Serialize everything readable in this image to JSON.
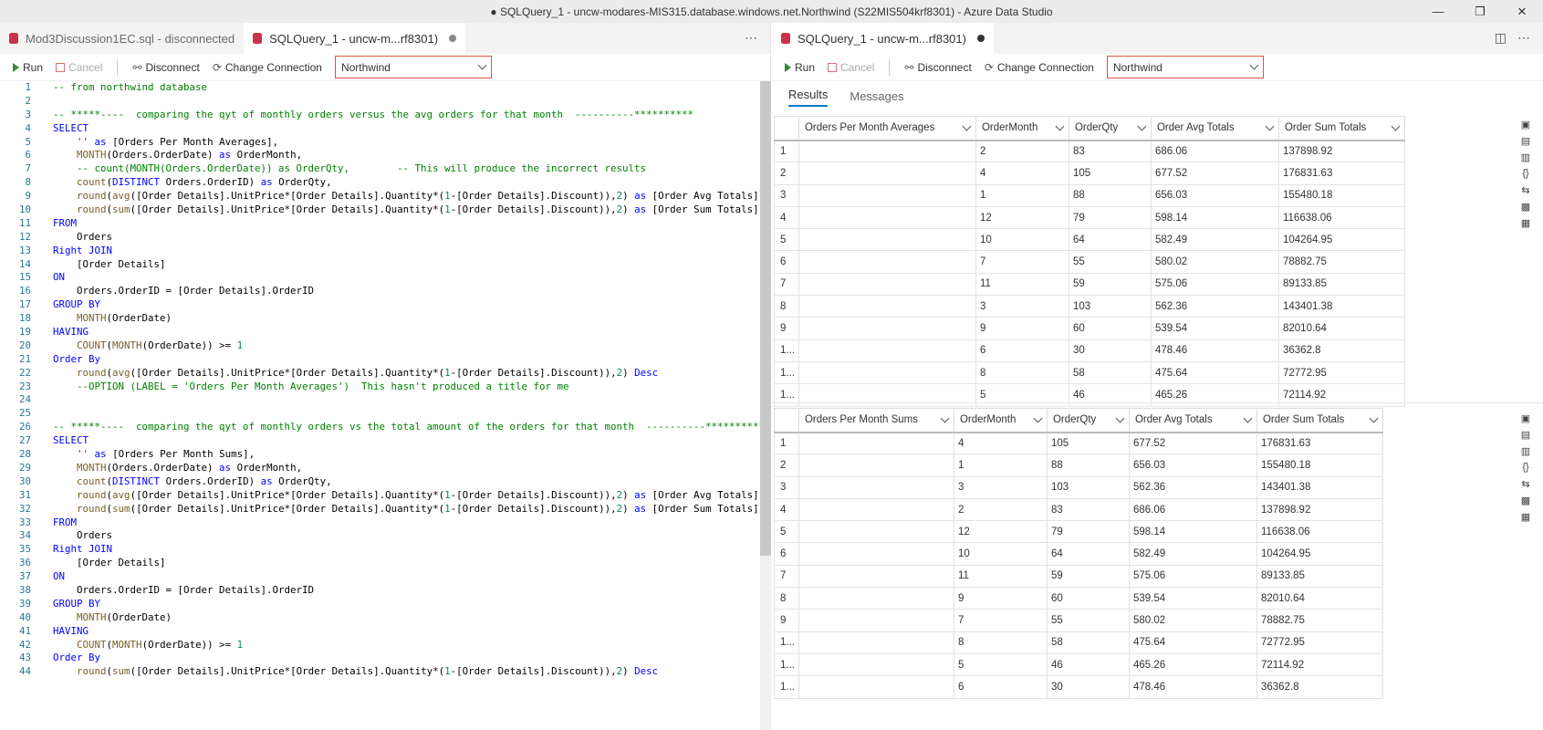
{
  "window": {
    "title": "● SQLQuery_1 - uncw-modares-MIS315.database.windows.net.Northwind (S22MIS504krf8301) - Azure Data Studio"
  },
  "left_tabs": [
    {
      "label": "Mod3Discussion1EC.sql - disconnected"
    },
    {
      "label": "SQLQuery_1 - uncw-m...rf8301)"
    }
  ],
  "right_tab": {
    "label": "SQLQuery_1 - uncw-m...rf8301)"
  },
  "toolbar": {
    "run": "Run",
    "cancel": "Cancel",
    "disconnect": "Disconnect",
    "change_connection": "Change Connection",
    "database": "Northwind"
  },
  "results_tabs": {
    "results": "Results",
    "messages": "Messages"
  },
  "editor_lines": [
    "1",
    "2",
    "3",
    "4",
    "5",
    "6",
    "7",
    "8",
    "9",
    "10",
    "11",
    "12",
    "13",
    "14",
    "15",
    "16",
    "17",
    "18",
    "19",
    "20",
    "21",
    "22",
    "23",
    "24",
    "25",
    "26",
    "27",
    "28",
    "29",
    "30",
    "31",
    "32",
    "33",
    "34",
    "35",
    "36",
    "37",
    "38",
    "39",
    "40",
    "41",
    "42",
    "43",
    "44"
  ],
  "code": [
    "-- from northwind database",
    "",
    "-- *****----  comparing the qyt of monthly orders versus the avg orders for that month  ----------**********",
    "SELECT",
    "    '' as [Orders Per Month Averages],",
    "    MONTH(Orders.OrderDate) as OrderMonth,",
    "    -- count(MONTH(Orders.OrderDate)) as OrderQty,        -- This will produce the incorrect results",
    "    count(DISTINCT Orders.OrderID) as OrderQty,",
    "    round(avg([Order Details].UnitPrice*[Order Details].Quantity*(1-[Order Details].Discount)),2) as [Order Avg Totals],",
    "    round(sum([Order Details].UnitPrice*[Order Details].Quantity*(1-[Order Details].Discount)),2) as [Order Sum Totals]",
    "FROM",
    "    Orders",
    "Right JOIN",
    "    [Order Details]",
    "ON",
    "    Orders.OrderID = [Order Details].OrderID",
    "GROUP BY",
    "    MONTH(OrderDate)",
    "HAVING",
    "    COUNT(MONTH(OrderDate)) >= 1",
    "Order By",
    "    round(avg([Order Details].UnitPrice*[Order Details].Quantity*(1-[Order Details].Discount)),2) Desc",
    "    --OPTION (LABEL = 'Orders Per Month Averages')  This hasn't produced a title for me",
    "",
    "",
    "-- *****----  comparing the qyt of monthly orders vs the total amount of the orders for that month  ----------**********",
    "SELECT",
    "    '' as [Orders Per Month Sums],",
    "    MONTH(Orders.OrderDate) as OrderMonth,",
    "    count(DISTINCT Orders.OrderID) as OrderQty,",
    "    round(avg([Order Details].UnitPrice*[Order Details].Quantity*(1-[Order Details].Discount)),2) as [Order Avg Totals],",
    "    round(sum([Order Details].UnitPrice*[Order Details].Quantity*(1-[Order Details].Discount)),2) as [Order Sum Totals]",
    "FROM",
    "    Orders",
    "Right JOIN",
    "    [Order Details]",
    "ON",
    "    Orders.OrderID = [Order Details].OrderID",
    "GROUP BY",
    "    MONTH(OrderDate)",
    "HAVING",
    "    COUNT(MONTH(OrderDate)) >= 1",
    "Order By",
    "    round(sum([Order Details].UnitPrice*[Order Details].Quantity*(1-[Order Details].Discount)),2) Desc"
  ],
  "grid1": {
    "columns": [
      "Orders Per Month Averages",
      "OrderMonth",
      "OrderQty",
      "Order Avg Totals",
      "Order Sum Totals"
    ],
    "rows": [
      [
        "1",
        "",
        "2",
        "83",
        "686.06",
        "137898.92"
      ],
      [
        "2",
        "",
        "4",
        "105",
        "677.52",
        "176831.63"
      ],
      [
        "3",
        "",
        "1",
        "88",
        "656.03",
        "155480.18"
      ],
      [
        "4",
        "",
        "12",
        "79",
        "598.14",
        "116638.06"
      ],
      [
        "5",
        "",
        "10",
        "64",
        "582.49",
        "104264.95"
      ],
      [
        "6",
        "",
        "7",
        "55",
        "580.02",
        "78882.75"
      ],
      [
        "7",
        "",
        "11",
        "59",
        "575.06",
        "89133.85"
      ],
      [
        "8",
        "",
        "3",
        "103",
        "562.36",
        "143401.38"
      ],
      [
        "9",
        "",
        "9",
        "60",
        "539.54",
        "82010.64"
      ],
      [
        "1...",
        "",
        "6",
        "30",
        "478.46",
        "36362.8"
      ],
      [
        "1...",
        "",
        "8",
        "58",
        "475.64",
        "72772.95"
      ],
      [
        "1...",
        "",
        "5",
        "46",
        "465.26",
        "72114.92"
      ]
    ]
  },
  "grid2": {
    "columns": [
      "Orders Per Month Sums",
      "OrderMonth",
      "OrderQty",
      "Order Avg Totals",
      "Order Sum Totals"
    ],
    "rows": [
      [
        "1",
        "",
        "4",
        "105",
        "677.52",
        "176831.63"
      ],
      [
        "2",
        "",
        "1",
        "88",
        "656.03",
        "155480.18"
      ],
      [
        "3",
        "",
        "3",
        "103",
        "562.36",
        "143401.38"
      ],
      [
        "4",
        "",
        "2",
        "83",
        "686.06",
        "137898.92"
      ],
      [
        "5",
        "",
        "12",
        "79",
        "598.14",
        "116638.06"
      ],
      [
        "6",
        "",
        "10",
        "64",
        "582.49",
        "104264.95"
      ],
      [
        "7",
        "",
        "11",
        "59",
        "575.06",
        "89133.85"
      ],
      [
        "8",
        "",
        "9",
        "60",
        "539.54",
        "82010.64"
      ],
      [
        "9",
        "",
        "7",
        "55",
        "580.02",
        "78882.75"
      ],
      [
        "1...",
        "",
        "8",
        "58",
        "475.64",
        "72772.95"
      ],
      [
        "1...",
        "",
        "5",
        "46",
        "465.26",
        "72114.92"
      ],
      [
        "1...",
        "",
        "6",
        "30",
        "478.46",
        "36362.8"
      ]
    ]
  }
}
